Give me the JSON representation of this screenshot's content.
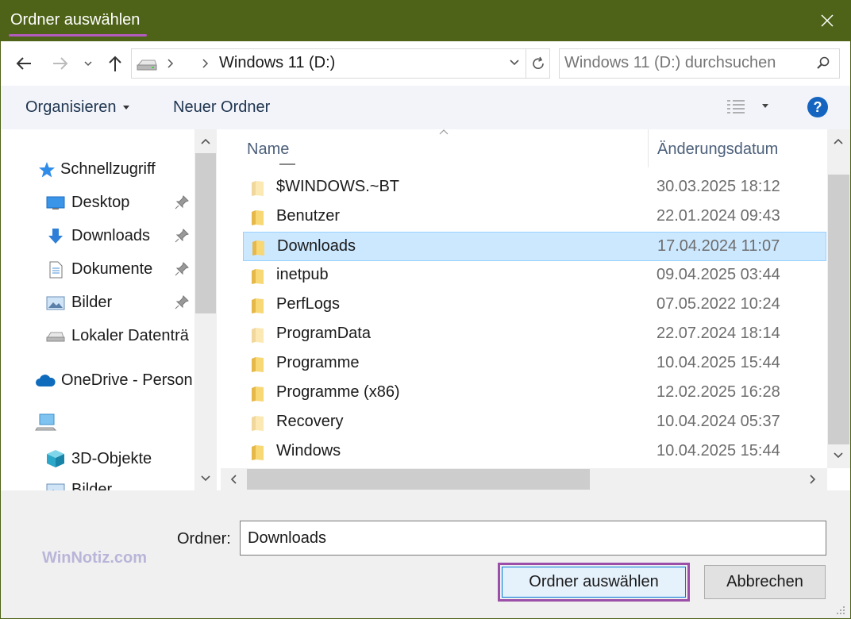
{
  "window": {
    "title": "Ordner auswählen"
  },
  "navigation": {
    "address_path": "Windows 11 (D:)",
    "search_placeholder": "Windows 11 (D:) durchsuchen"
  },
  "toolbar": {
    "organize_label": "Organisieren",
    "new_folder_label": "Neuer Ordner"
  },
  "sidebar": {
    "items": [
      {
        "label": "Schnellzugriff",
        "icon": "star-icon"
      },
      {
        "label": "Desktop",
        "icon": "desktop-icon",
        "pinned": true
      },
      {
        "label": "Downloads",
        "icon": "download-arrow-icon",
        "pinned": true
      },
      {
        "label": "Dokumente",
        "icon": "document-icon",
        "pinned": true
      },
      {
        "label": "Bilder",
        "icon": "pictures-icon",
        "pinned": true
      },
      {
        "label": "Lokaler Datenträ",
        "icon": "drive-icon"
      },
      {
        "label": "OneDrive - Person",
        "icon": "cloud-icon"
      },
      {
        "label": "",
        "icon": "computer-icon"
      },
      {
        "label": "3D-Objekte",
        "icon": "cube-icon"
      },
      {
        "label": "Bilder",
        "icon": "pictures-icon"
      }
    ]
  },
  "file_list": {
    "columns": {
      "name": "Name",
      "date": "Änderungsdatum"
    },
    "rows": [
      {
        "name": "$WINDOWS.~BT",
        "date": "30.03.2025 18:12",
        "hidden": true,
        "selected": false
      },
      {
        "name": "Benutzer",
        "date": "22.01.2024 09:43",
        "hidden": false,
        "selected": false
      },
      {
        "name": "Downloads",
        "date": "17.04.2024 11:07",
        "hidden": false,
        "selected": true
      },
      {
        "name": "inetpub",
        "date": "09.04.2025 03:44",
        "hidden": false,
        "selected": false
      },
      {
        "name": "PerfLogs",
        "date": "07.05.2022 10:24",
        "hidden": false,
        "selected": false
      },
      {
        "name": "ProgramData",
        "date": "22.07.2024 18:14",
        "hidden": true,
        "selected": false
      },
      {
        "name": "Programme",
        "date": "10.04.2025 15:44",
        "hidden": false,
        "selected": false
      },
      {
        "name": "Programme (x86)",
        "date": "12.02.2025 16:28",
        "hidden": false,
        "selected": false
      },
      {
        "name": "Recovery",
        "date": "10.04.2024 05:37",
        "hidden": true,
        "selected": false
      },
      {
        "name": "Windows",
        "date": "10.04.2025 15:44",
        "hidden": false,
        "selected": false
      }
    ]
  },
  "footer": {
    "folder_label": "Ordner:",
    "folder_value": "Downloads",
    "select_button": "Ordner auswählen",
    "cancel_button": "Abbrechen",
    "watermark": "WinNotiz.com"
  },
  "colors": {
    "titlebar": "#4e6317",
    "highlight_outline": "#9b4fa8",
    "selection": "#cce8ff",
    "folder": "#f8d775"
  }
}
